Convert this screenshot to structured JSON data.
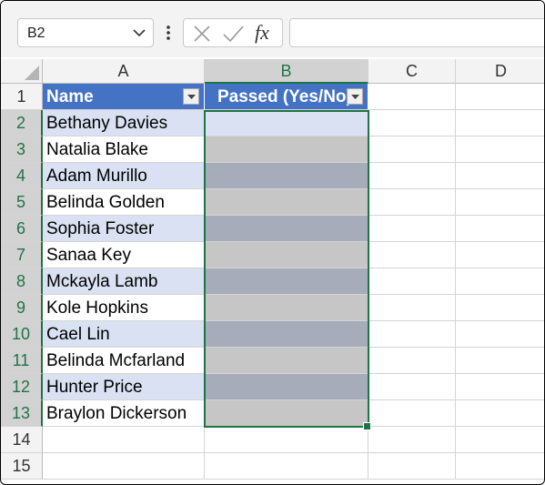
{
  "name_box": {
    "value": "B2"
  },
  "formula_bar": {
    "fx_label": "fx",
    "content": ""
  },
  "columns": [
    "A",
    "B",
    "C",
    "D"
  ],
  "rows": [
    "1",
    "2",
    "3",
    "4",
    "5",
    "6",
    "7",
    "8",
    "9",
    "10",
    "11",
    "12",
    "13",
    "14",
    "15"
  ],
  "table": {
    "headers": [
      "Name",
      "Passed (Yes/No)"
    ],
    "names": [
      "Bethany Davies",
      "Natalia Blake",
      "Adam Murillo",
      "Belinda Golden",
      "Sophia Foster",
      "Sanaa Key",
      "Mckayla Lamb",
      "Kole Hopkins",
      "Cael Lin",
      "Belinda Mcfarland",
      "Hunter Price",
      "Braylon Dickerson"
    ]
  },
  "colors": {
    "table_header": "#4472c4",
    "band_light": "#d9e1f2",
    "selection": "#217346",
    "fill_dark": "#a6acb9",
    "fill_light": "#c6c6c6"
  }
}
